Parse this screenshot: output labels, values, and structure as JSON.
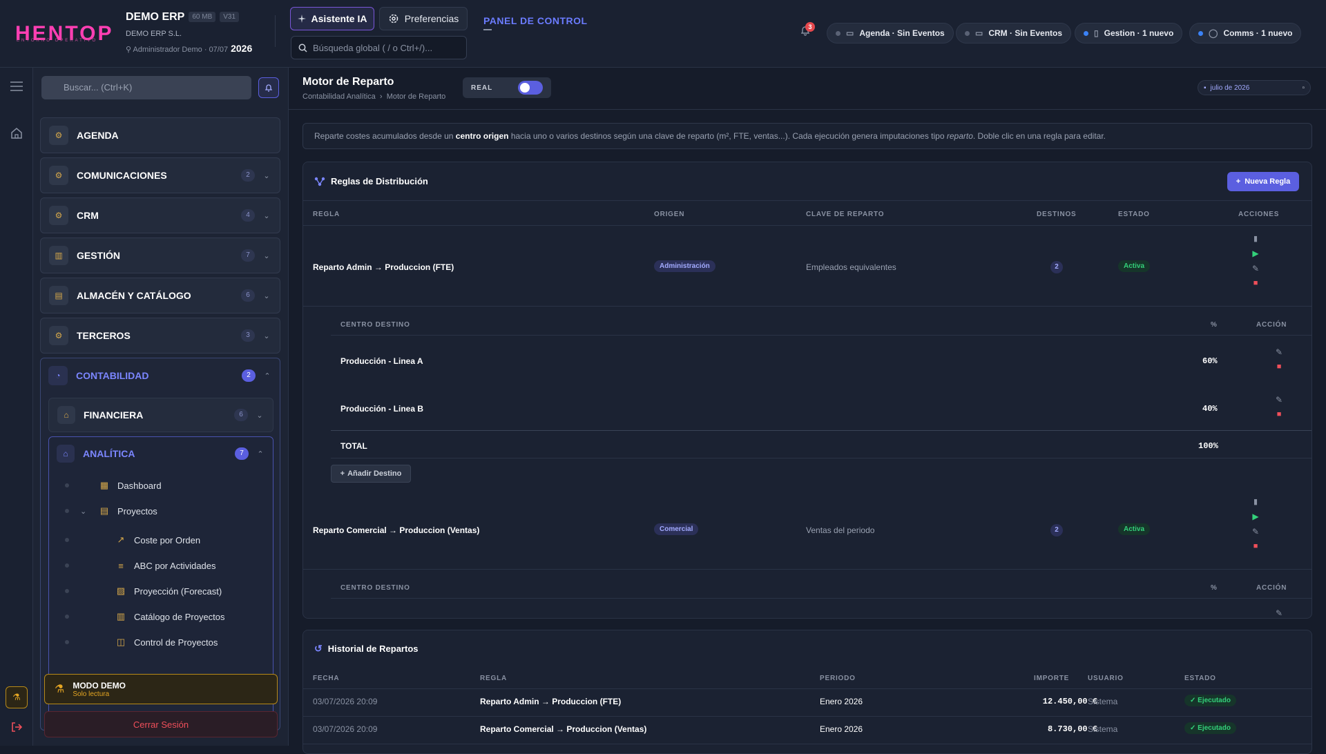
{
  "header": {
    "logo": "HENTOP",
    "logo_sub": "ENTORNO OPERATIVO",
    "company": "DEMO ERP",
    "chip_size": "60 MB",
    "chip_ver": "V31",
    "company_legal": "DEMO ERP S.L.",
    "user": "Administrador Demo",
    "date_short": "07/07",
    "year": "2026",
    "ai_label": "Asistente IA",
    "pref_label": "Preferencias",
    "search_placeholder": "Búsqueda global ( / o Ctrl+/)...",
    "panel_title": "PANEL DE CONTROL",
    "notif_count": "3",
    "pills": [
      {
        "label": "Agenda · Sin Eventos"
      },
      {
        "label": "CRM · Sin Eventos"
      },
      {
        "label": "Gestion · 1 nuevo"
      },
      {
        "label": "Comms · 1 nuevo"
      }
    ]
  },
  "sidebar": {
    "search_placeholder": "Buscar... (Ctrl+K)",
    "items": [
      {
        "label": "AGENDA",
        "count": ""
      },
      {
        "label": "COMUNICACIONES",
        "count": "2"
      },
      {
        "label": "CRM",
        "count": "4"
      },
      {
        "label": "GESTIÓN",
        "count": "7"
      },
      {
        "label": "ALMACÉN Y CATÁLOGO",
        "count": "6"
      },
      {
        "label": "TERCEROS",
        "count": "3"
      },
      {
        "label": "CONTABILIDAD",
        "count": "2"
      }
    ],
    "financiera": {
      "label": "FINANCIERA",
      "count": "6"
    },
    "analitica": {
      "label": "ANALÍTICA",
      "count": "7"
    },
    "tree": [
      "Dashboard",
      "Proyectos",
      "Coste por Orden",
      "ABC por Actividades",
      "Proyección (Forecast)",
      "Catálogo de Proyectos",
      "Control de Proyectos"
    ],
    "demo_title": "MODO DEMO",
    "demo_sub": "Solo lectura",
    "logout": "Cerrar Sesión"
  },
  "main": {
    "title": "Motor de Reparto",
    "crumb1": "Contabilidad Analítica",
    "crumb2": "Motor de Reparto",
    "real_label": "REAL",
    "date": "julio de 2026",
    "info_a": "Reparte costes acumulados desde un ",
    "info_b": "centro origen",
    "info_c": " hacia uno o varios destinos según una clave de reparto (m², FTE, ventas...). Cada ejecución genera imputaciones tipo ",
    "info_d": "reparto",
    "info_e": ". Doble clic en una regla para editar.",
    "rules": {
      "title": "Reglas de Distribución",
      "new_btn": "Nueva Regla",
      "cols": [
        "REGLA",
        "ORIGEN",
        "CLAVE DE REPARTO",
        "DESTINOS",
        "ESTADO",
        "ACCIONES"
      ],
      "sub_cols": [
        "CENTRO DESTINO",
        "%",
        "ACCIÓN"
      ],
      "rows": [
        {
          "name": "Reparto Admin → Produccion (FTE)",
          "origin": "Administración",
          "key": "Empleados equivalentes",
          "dest": "2",
          "status": "Activa"
        },
        {
          "name": "Reparto Comercial → Produccion (Ventas)",
          "origin": "Comercial",
          "key": "Ventas del periodo",
          "dest": "2",
          "status": "Activa"
        }
      ],
      "dests": [
        {
          "name": "Producción - Linea A",
          "pct": "60%"
        },
        {
          "name": "Producción - Linea B",
          "pct": "40%"
        }
      ],
      "total_label": "TOTAL",
      "total_pct": "100%",
      "add_dest": "Añadir Destino"
    },
    "history": {
      "title": "Historial de Repartos",
      "cols": [
        "FECHA",
        "REGLA",
        "PERIODO",
        "IMPORTE",
        "USUARIO",
        "ESTADO"
      ],
      "rows": [
        {
          "date": "03/07/2026 20:09",
          "rule": "Reparto Admin → Produccion (FTE)",
          "period": "Enero 2026",
          "amount": "12.450,00 €",
          "user": "Sistema",
          "status": "Ejecutado"
        },
        {
          "date": "03/07/2026 20:09",
          "rule": "Reparto Comercial → Produccion (Ventas)",
          "period": "Enero 2026",
          "amount": "8.730,00 €",
          "user": "Sistema",
          "status": "Ejecutado"
        }
      ]
    }
  }
}
